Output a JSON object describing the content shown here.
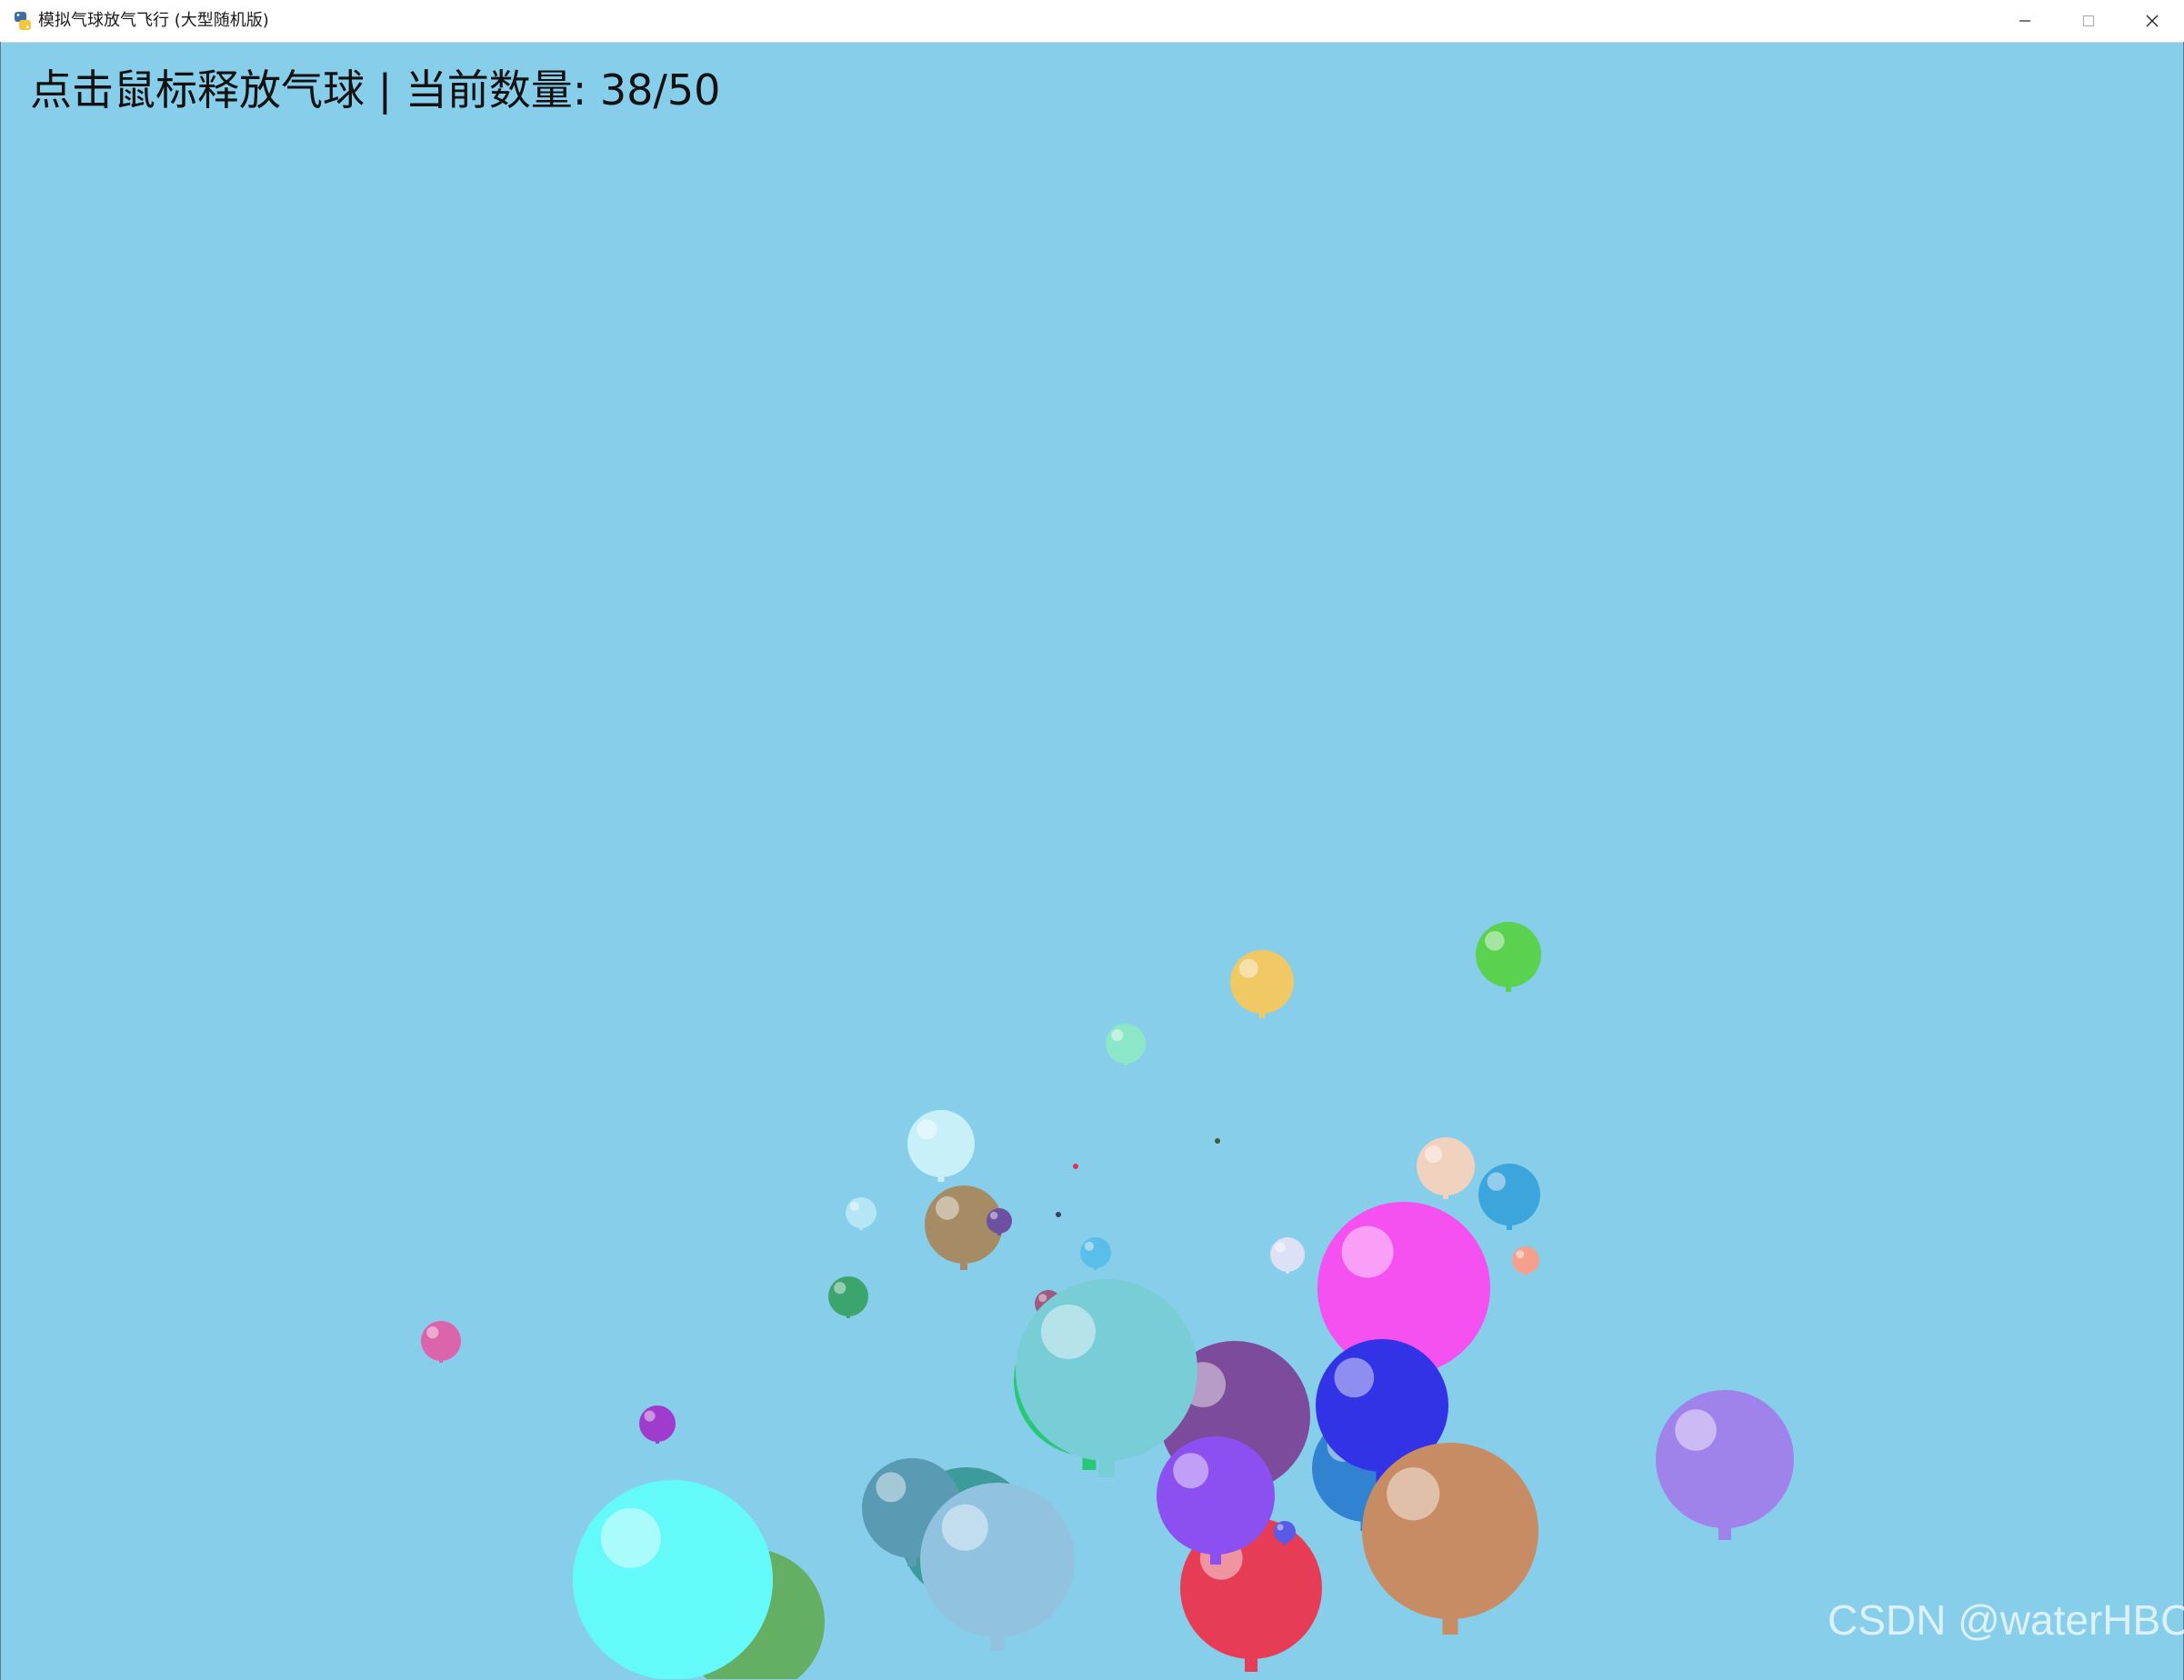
{
  "window": {
    "title": "模拟气球放气飞行 (大型随机版)",
    "icon": "python-snake-icon",
    "controls": {
      "minimize": "minimize-icon",
      "maximize": "maximize-icon",
      "close": "close-icon"
    }
  },
  "hud": {
    "text": "点击鼠标释放气球 | 当前数量: 38/50"
  },
  "scene": {
    "background_color": "#87ceeb",
    "balloons": [
      {
        "color": "#f0c864",
        "size": "small"
      },
      {
        "color": "#5ad250",
        "size": "small"
      },
      {
        "color": "#8ce6c8",
        "size": "tiny"
      },
      {
        "color": "#c8f0f8",
        "size": "small"
      },
      {
        "color": "#f0d2be",
        "size": "small"
      },
      {
        "color": "#3ca5dc",
        "size": "small"
      },
      {
        "color": "#b4e6f5",
        "size": "tiny"
      },
      {
        "color": "#a58c64",
        "size": "small"
      },
      {
        "color": "#6e50a0",
        "size": "tiny"
      },
      {
        "color": "#5abeeb",
        "size": "tiny"
      },
      {
        "color": "#dce1f5",
        "size": "tiny"
      },
      {
        "color": "#f5a08c",
        "size": "tiny"
      },
      {
        "color": "#3ca56e",
        "size": "tiny"
      },
      {
        "color": "#dc64aa",
        "size": "tiny"
      },
      {
        "color": "#a03ccd",
        "size": "tiny"
      },
      {
        "color": "#a05a82",
        "size": "tiny"
      },
      {
        "color": "#f550f0",
        "size": "large"
      },
      {
        "color": "#28c878",
        "size": "large"
      },
      {
        "color": "#7d4b9b",
        "size": "large"
      },
      {
        "color": "#78cdd7",
        "size": "large"
      },
      {
        "color": "#3c9b9b",
        "size": "medium"
      },
      {
        "color": "#3282d2",
        "size": "medium"
      },
      {
        "color": "#3232e6",
        "size": "large"
      },
      {
        "color": "#a082eb",
        "size": "large"
      },
      {
        "color": "#64af64",
        "size": "large"
      },
      {
        "color": "#64fafa",
        "size": "large"
      },
      {
        "color": "#5a9bb4",
        "size": "medium"
      },
      {
        "color": "#91c3e1",
        "size": "large"
      },
      {
        "color": "#e63c55",
        "size": "large"
      },
      {
        "color": "#8c50f0",
        "size": "medium"
      },
      {
        "color": "#5a5ae6",
        "size": "tiny"
      },
      {
        "color": "#c88c64",
        "size": "large"
      }
    ],
    "particles": [
      {
        "color": "#dc3250"
      },
      {
        "color": "#3c5a3c"
      },
      {
        "color": "#3c3c64"
      }
    ]
  },
  "watermark": "CSDN @waterHBO"
}
